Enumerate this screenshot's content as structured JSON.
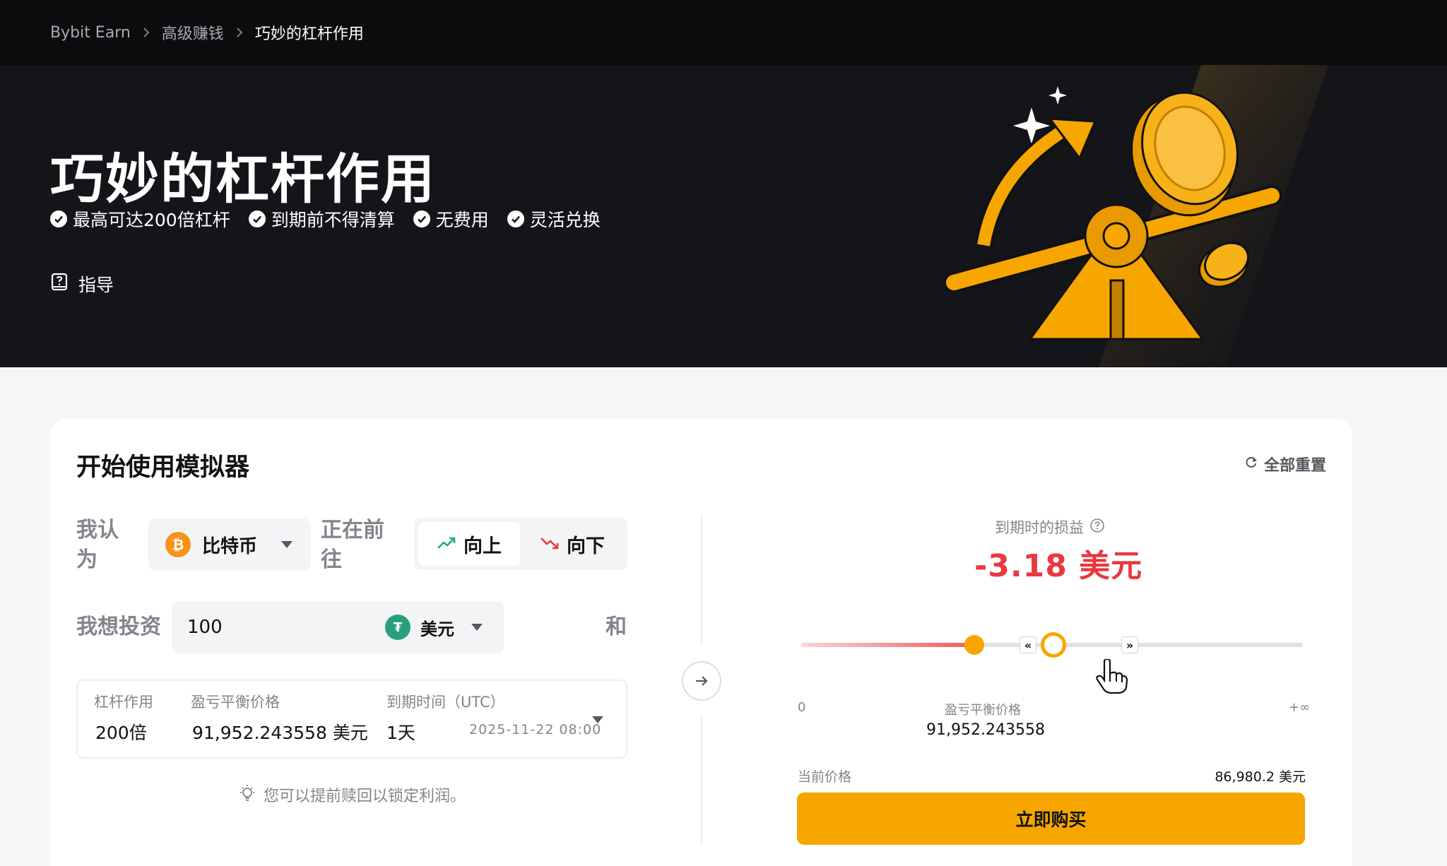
{
  "breadcrumb": {
    "items": [
      "Bybit Earn",
      "高级赚钱",
      "巧妙的杠杆作用"
    ]
  },
  "hero": {
    "title": "巧妙的杠杆作用",
    "features": [
      "最高可达200倍杠杆",
      "到期前不得清算",
      "无费用",
      "灵活兑换"
    ],
    "guide_label": "指导"
  },
  "simulator": {
    "title": "开始使用模拟器",
    "reset_label": "全部重置",
    "i_think_label": "我认为",
    "coin": {
      "name": "比特币",
      "icon": "bitcoin-icon"
    },
    "going_label": "正在前往",
    "direction": {
      "up_label": "向上",
      "down_label": "向下",
      "selected": "向上"
    },
    "invest_label": "我想投资",
    "amount_value": "100",
    "currency": {
      "name": "美元",
      "icon": "usdt-icon"
    },
    "and_label": "和",
    "params": {
      "leverage_label": "杠杆作用",
      "leverage_value": "200倍",
      "breakeven_label": "盈亏平衡价格",
      "breakeven_value": "91,952.243558 美元",
      "expiry_label": "到期时间（UTC）",
      "expiry_value": "1天",
      "expiry_date": "2025-11-22 08:00"
    },
    "tip": "您可以提前赎回以锁定利润。"
  },
  "result": {
    "pnl_label": "到期时的损益",
    "pnl_value": "-3.18 美元",
    "slider": {
      "min_label": "0",
      "max_label": "+∞",
      "breakeven_label": "盈亏平衡价格",
      "breakeven_value": "91,952.243558",
      "prev_label": "«",
      "next_label": "»"
    },
    "current_price_label": "当前价格",
    "current_price_value": "86,980.2 美元",
    "buy_label": "立即购买"
  },
  "colors": {
    "accent": "#f7a600",
    "loss": "#e9383f",
    "gain": "#20b26c",
    "hero_bg": "#141519"
  }
}
